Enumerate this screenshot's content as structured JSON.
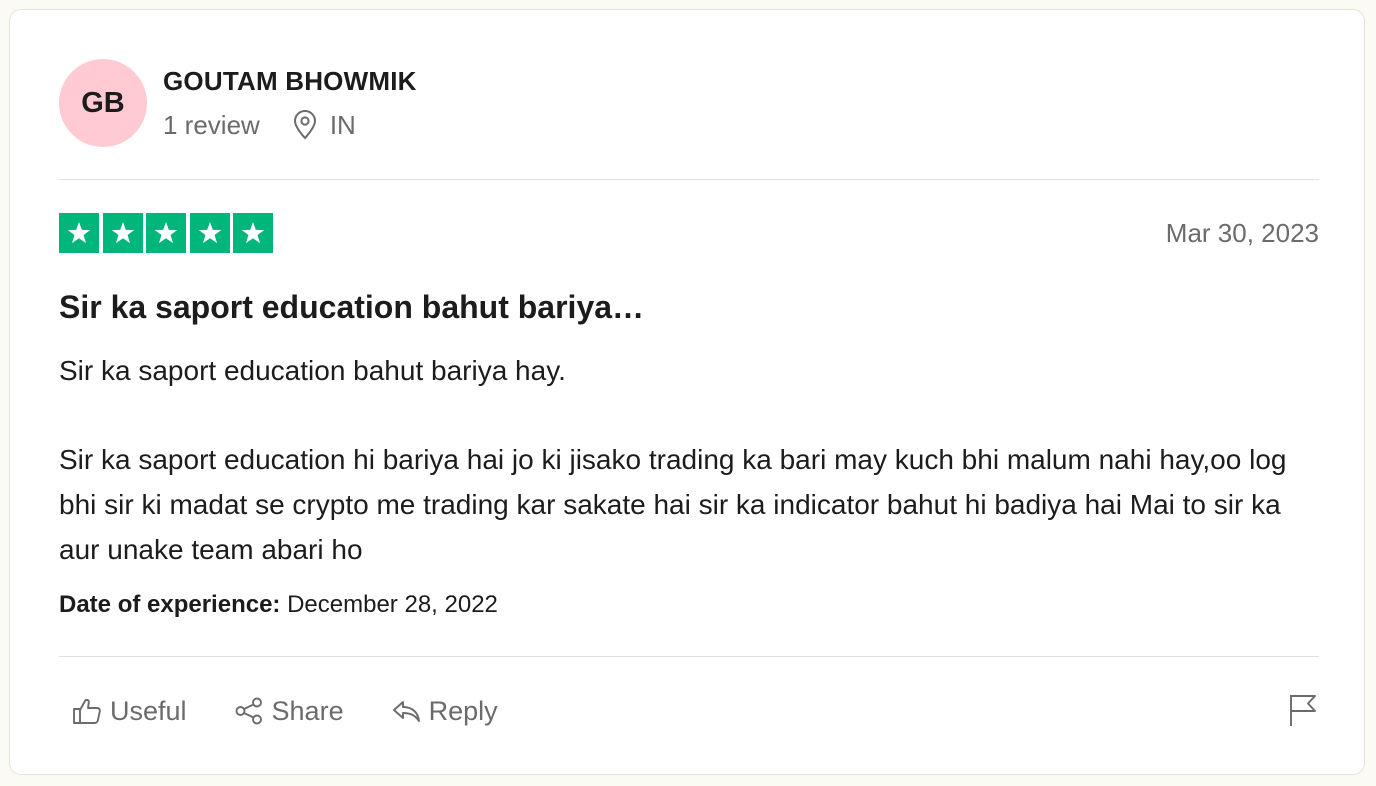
{
  "consumer": {
    "initials": "GB",
    "name": "GOUTAM BHOWMIK",
    "review_count": "1 review",
    "country": "IN",
    "avatar_color": "#ffcad2"
  },
  "review": {
    "rating": 5,
    "max_rating": 5,
    "star_color": "#00b67a",
    "date": "Mar 30, 2023",
    "title": "Sir ka saport education bahut bariya…",
    "paragraphs": [
      "Sir ka saport education bahut bariya hay.",
      "Sir ka saport education hi bariya hai jo ki jisako trading ka bari may kuch bhi malum nahi hay,oo log bhi sir ki madat se crypto me trading kar sakate hai sir ka indicator bahut hi badiya hai Mai to sir ka aur unake team abari ho"
    ],
    "experience_label": "Date of experience:",
    "experience_date": "December 28, 2022"
  },
  "actions": {
    "useful_label": "Useful",
    "share_label": "Share",
    "reply_label": "Reply"
  },
  "icons": {
    "location": "location-pin-icon",
    "useful": "thumbs-up-icon",
    "share": "share-icon",
    "reply": "reply-icon",
    "report": "flag-icon",
    "star": "star-icon"
  }
}
